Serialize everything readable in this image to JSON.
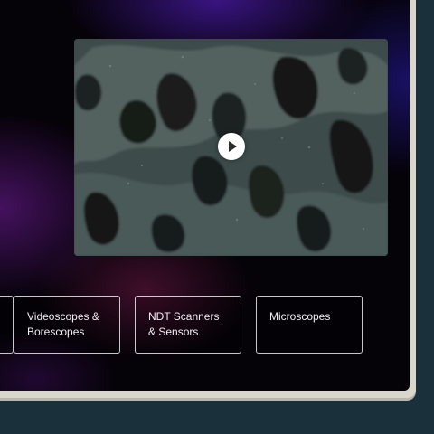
{
  "video": {
    "play_icon": "play-icon"
  },
  "categories": [
    {
      "label": ""
    },
    {
      "label": "Videoscopes & Borescopes"
    },
    {
      "label": "NDT Scanners & Sensors"
    },
    {
      "label": "Microscopes"
    }
  ],
  "colors": {
    "page_background": "#1a303a",
    "bezel": "#d9d7cd",
    "screen_base": "#050208",
    "card_border": "#ffffff",
    "card_text": "#f2eef6"
  }
}
